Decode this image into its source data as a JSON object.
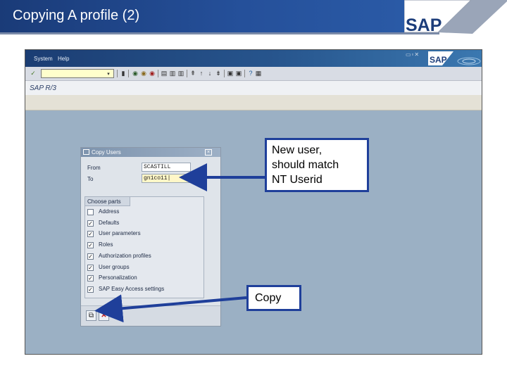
{
  "slide": {
    "title": "Copying A profile (2)",
    "logo_text": "SAP"
  },
  "gui": {
    "menu": {
      "system": "System",
      "help": "Help"
    },
    "logo_text": "SAP",
    "title": "SAP R/3"
  },
  "dialog": {
    "title": "Copy Users",
    "from_label": "From",
    "from_value": "SCASTILL",
    "to_label": "To",
    "to_value": "gn1co11|",
    "parts_title": "Choose parts",
    "parts": [
      {
        "label": "Address",
        "checked": false
      },
      {
        "label": "Defaults",
        "checked": true
      },
      {
        "label": "User parameters",
        "checked": true
      },
      {
        "label": "Roles",
        "checked": true
      },
      {
        "label": "Authorization profiles",
        "checked": true
      },
      {
        "label": "User groups",
        "checked": true
      },
      {
        "label": "Personalization",
        "checked": true
      },
      {
        "label": "SAP Easy Access settings",
        "checked": true
      }
    ]
  },
  "callouts": {
    "new_user": [
      "New user,",
      "should match",
      "NT Userid"
    ],
    "copy": "Copy"
  },
  "colors": {
    "header_blue": "#1a3b78",
    "callout_border": "#1f3f9a",
    "gui_background": "#9bb0c4",
    "required_field": "#fff7c8"
  }
}
